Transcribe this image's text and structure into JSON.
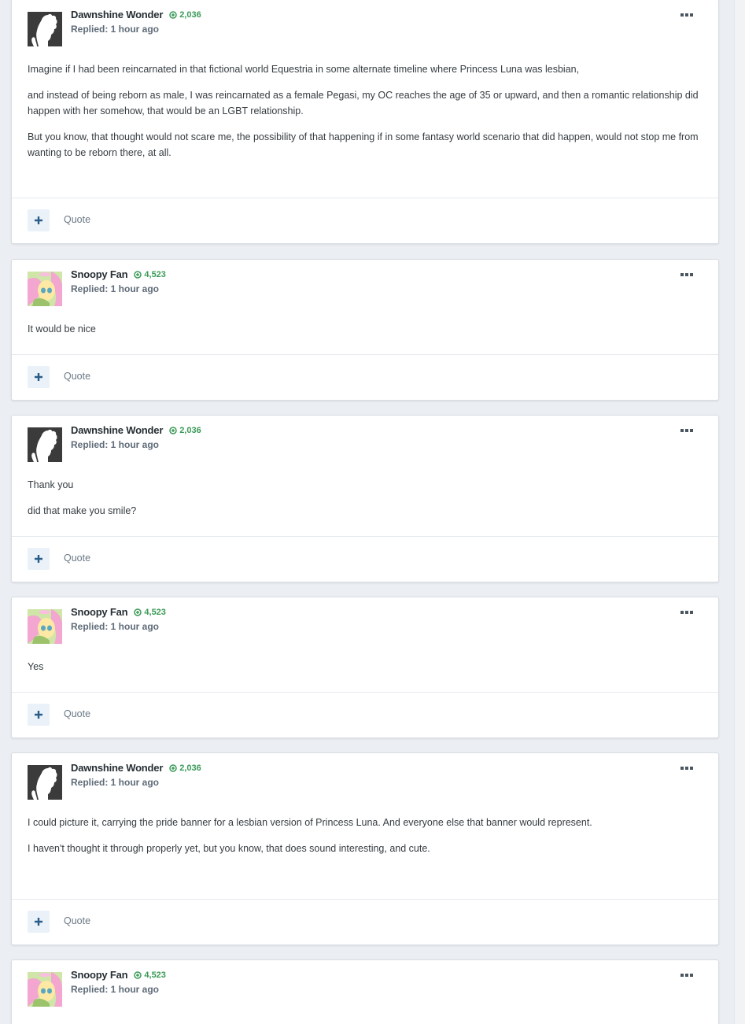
{
  "posts": [
    {
      "author": "Dawnshine Wonder",
      "reputation": "2,036",
      "replied": "Replied: 1 hour ago",
      "avatar": "white-pony-silhouette",
      "paragraphs": [
        "Imagine if I had been reincarnated in that fictional world Equestria in some alternate timeline where Princess Luna was lesbian,",
        "and instead of being reborn as male, I was reincarnated as a female Pegasi, my OC reaches the age of 35 or upward, and then a romantic relationship did happen with her somehow, that would be an LGBT relationship.",
        "But you know, that thought would not scare me, the possibility of that happening if in some fantasy world scenario that did happen, would not stop me from wanting to be reborn there, at all."
      ],
      "quote_label": "Quote"
    },
    {
      "author": "Snoopy Fan",
      "reputation": "4,523",
      "replied": "Replied: 1 hour ago",
      "avatar": "fluttershy-avatar",
      "paragraphs": [
        "It would be nice"
      ],
      "quote_label": "Quote"
    },
    {
      "author": "Dawnshine Wonder",
      "reputation": "2,036",
      "replied": "Replied: 1 hour ago",
      "avatar": "white-pony-silhouette",
      "paragraphs": [
        "Thank you",
        "did that make you smile?"
      ],
      "quote_label": "Quote"
    },
    {
      "author": "Snoopy Fan",
      "reputation": "4,523",
      "replied": "Replied: 1 hour ago",
      "avatar": "fluttershy-avatar",
      "paragraphs": [
        "Yes"
      ],
      "quote_label": "Quote"
    },
    {
      "author": "Dawnshine Wonder",
      "reputation": "2,036",
      "replied": "Replied: 1 hour ago",
      "avatar": "white-pony-silhouette",
      "paragraphs": [
        "I could picture it, carrying the pride banner for a lesbian version of Princess Luna. And everyone else that banner would represent.",
        "I haven't thought it through properly yet, but you know, that does sound interesting, and cute."
      ],
      "quote_label": "Quote"
    },
    {
      "author": "Snoopy Fan",
      "reputation": "4,523",
      "replied": "Replied: 1 hour ago",
      "avatar": "fluttershy-avatar",
      "paragraphs": [],
      "quote_label": ""
    }
  ],
  "colors": {
    "reputation_green": "#3a9a57",
    "plus_icon": "#2a5d8a",
    "background": "#ebeef2"
  },
  "icons": {
    "reputation": "plus-circle-icon",
    "more": "ellipsis-icon",
    "react": "plus-icon"
  }
}
